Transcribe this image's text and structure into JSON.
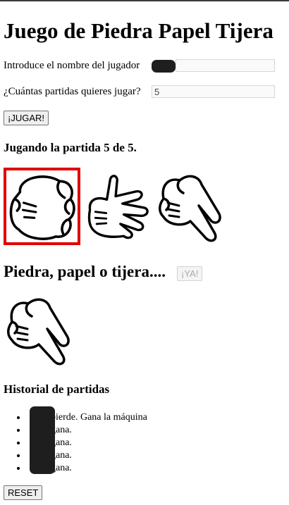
{
  "title": "Juego de Piedra Papel Tijera",
  "player_name": {
    "label": "Introduce el nombre del jugador",
    "value": ""
  },
  "games_count": {
    "label": "¿Cuántas partidas quieres jugar?",
    "value": "5"
  },
  "play_button": "¡JUGAR!",
  "round_status": "Jugando la partida 5 de 5.",
  "choices": [
    {
      "icon": "rock-hand-icon",
      "selected": true
    },
    {
      "icon": "paper-hand-icon",
      "selected": false
    },
    {
      "icon": "scissors-hand-icon",
      "selected": false
    }
  ],
  "prompt": "Piedra, papel o tijera....",
  "ya_button": "¡YA!",
  "machine_choice_icon": "scissors-hand-icon",
  "history": {
    "title": "Historial de partidas",
    "items": [
      "pierde. Gana la máquina",
      "gana.",
      "gana.",
      "gana.",
      "gana."
    ]
  },
  "reset_button": "RESET",
  "colors": {
    "selected_border": "#e10000",
    "redaction": "#1e1e1e"
  }
}
